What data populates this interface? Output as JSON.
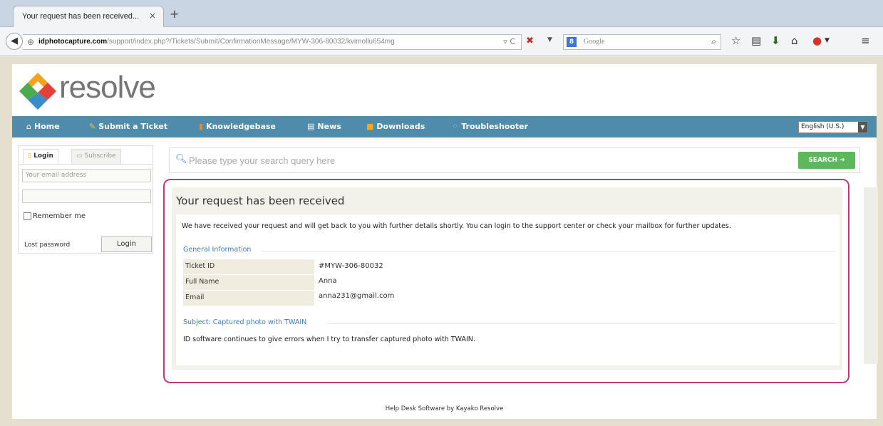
{
  "browser": {
    "tab_title": "Your request has been received...",
    "tab_close": "×",
    "new_tab": "+",
    "url_domain": "idphotocapture.com",
    "url_path": "/support/index.php?/Tickets/Submit/ConfirmationMessage/MYW-306-80032/kvimollu654mg",
    "url_controls": "▿ C",
    "search_engine_label": "8",
    "search_placeholder": "Google",
    "search_mag": "⌕"
  },
  "site": {
    "logo_text": "resolve",
    "nav": {
      "home": "Home",
      "submit": "Submit a Ticket",
      "kb": "Knowledgebase",
      "news": "News",
      "downloads": "Downloads",
      "troubleshooter": "Troubleshooter"
    },
    "language": "English (U.S.)"
  },
  "login": {
    "tab_login": "Login",
    "tab_subscribe": "Subscribe",
    "email_placeholder": "Your email address",
    "password_value": "",
    "remember_label": "Remember me",
    "lost_password": "Lost password",
    "login_button": "Login"
  },
  "search": {
    "placeholder": "Please type your search query here",
    "button": "SEARCH"
  },
  "confirmation": {
    "title": "Your request has been received",
    "message": "We have received your request and will get back to you with further details shortly. You can login to the support center or check your mailbox for further updates.",
    "general_info_title": "General Information",
    "fields": [
      {
        "label": "Ticket ID",
        "value": "#MYW-306-80032"
      },
      {
        "label": "Full Name",
        "value": "Anna"
      },
      {
        "label": "Email",
        "value": "anna231@gmail.com"
      }
    ],
    "subject_title": "Subject: Captured photo with TWAIN",
    "subject_body": "ID software continues to give errors when I try to transfer captured photo with TWAIN."
  },
  "footer": "Help Desk Software by Kayako Resolve",
  "colors": {
    "menu": "#4f8bab",
    "highlight": "#c0397a",
    "search_button": "#5cb85c",
    "link": "#3d7ec2"
  }
}
